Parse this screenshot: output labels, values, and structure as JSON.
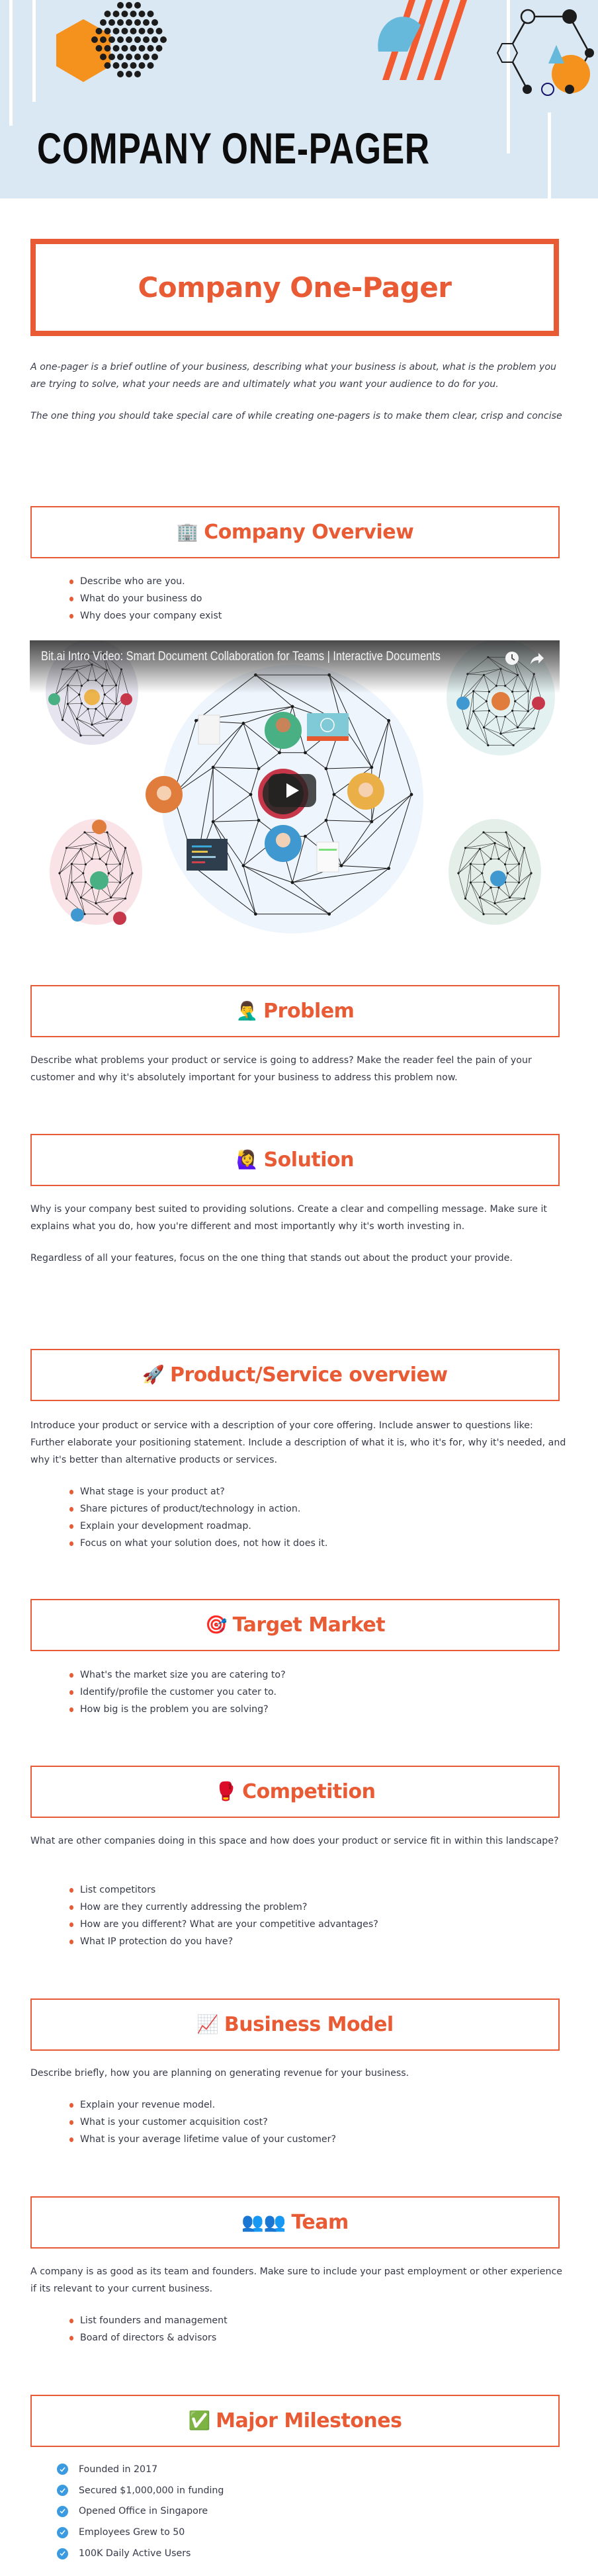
{
  "banner": {
    "title": "COMPANY ONE-PAGER"
  },
  "main_title": "Company One-Pager",
  "intro": [
    "A one-pager is a brief outline of your business, describing what your business is about, what is the problem you are trying to solve, what your needs are and ultimately what you want your audience to do for you.",
    "The one thing you should take special care of while creating one-pagers is to make them clear, crisp and concise"
  ],
  "colors": {
    "accent": "#e85b34",
    "banner_bg": "#dae8f4",
    "check_blue": "#3b9be0",
    "body_text": "#363948"
  },
  "sections": {
    "overview": {
      "emoji": "🏢",
      "icon": "office-building-icon",
      "title": "Company Overview",
      "bullets": [
        "Describe who are you.",
        "What do your business do",
        "Why does your company exist"
      ]
    },
    "video": {
      "title": "Bit.ai Intro Video: Smart Document Collaboration for Teams | Interactive Documents",
      "watch_later_icon": "clock-icon",
      "share_icon": "share-arrow-icon",
      "play_icon": "play-icon"
    },
    "problem": {
      "emoji": "🤦‍♂️",
      "icon": "facepalm-icon",
      "title": "Problem",
      "paragraphs": [
        "Describe what problems your product or service is going to address? Make the reader feel the pain of your customer and why it's absolutely important for your business to address this problem now."
      ]
    },
    "solution": {
      "emoji": "🙋‍♀️",
      "icon": "raising-hand-icon",
      "title": "Solution",
      "paragraphs": [
        "Why is your company best suited to providing solutions. Create a clear and compelling message. Make sure it explains what you do, how you're different and most importantly why it's worth investing in.",
        "Regardless of all your features, focus on the one thing that stands out about the product your provide."
      ]
    },
    "product": {
      "emoji": "🚀",
      "icon": "rocket-icon",
      "title": "Product/Service overview",
      "paragraphs": [
        "Introduce your product or service with a description of your core offering. Include answer to questions like: Further elaborate your positioning statement. Include a description of what it is, who it's for, why it's needed, and why it's better than alternative products or services."
      ],
      "bullets": [
        "What stage is your product at?",
        "Share pictures of product/technology in action.",
        "Explain your development roadmap.",
        "Focus on what your solution does, not how it does it."
      ]
    },
    "target": {
      "emoji": "🎯",
      "icon": "target-dart-icon",
      "title": "Target Market",
      "bullets": [
        "What's the market size you are catering to?",
        "Identify/profile the customer you cater to.",
        "How big is the problem you are solving?"
      ]
    },
    "competition": {
      "emoji": "🥊",
      "icon": "boxing-glove-icon",
      "title": "Competition",
      "paragraphs": [
        "What are other companies doing in this space and how does your product or service fit in within this landscape?"
      ],
      "bullets": [
        "List competitors",
        "How are they currently addressing the problem?",
        "How are you different? What are your competitive advantages?",
        "What IP protection do you have?"
      ]
    },
    "business": {
      "emoji": "📈",
      "icon": "chart-increasing-icon",
      "title": "Business Model",
      "paragraphs": [
        "Describe briefly, how you are planning on generating revenue for your business."
      ],
      "bullets": [
        "Explain your revenue model.",
        "What is your customer acquisition cost?",
        "What is your average lifetime value of your customer?"
      ]
    },
    "team": {
      "emoji": "👥👥",
      "icon": "team-silhouettes-icon",
      "title": "Team",
      "paragraphs": [
        "A company is as good as its team and founders. Make sure to include your past employment or other experience if its relevant to your current business."
      ],
      "bullets": [
        "List founders and management",
        "Board of directors & advisors"
      ]
    },
    "milestones": {
      "emoji": "✅",
      "icon": "check-mark-button-icon",
      "title": "Major Milestones",
      "items": [
        "Founded in 2017",
        "Secured $1,000,000 in funding",
        "Opened Office in Singapore",
        "Employees Grew to 50",
        "100K Daily Active Users"
      ]
    }
  }
}
